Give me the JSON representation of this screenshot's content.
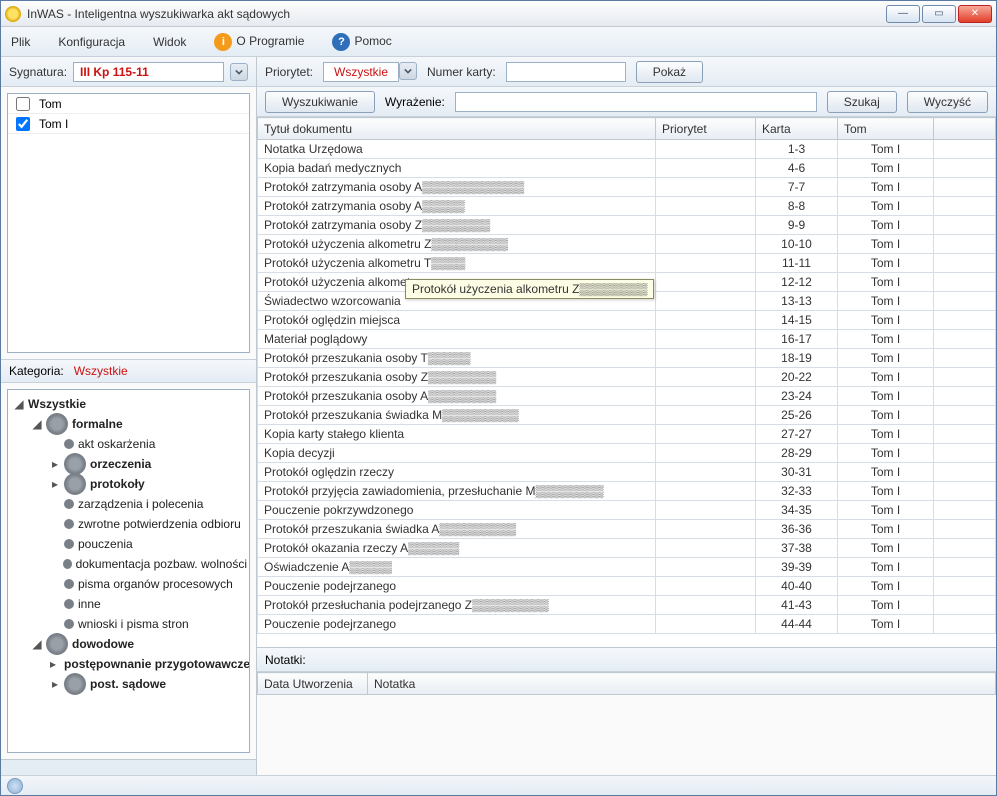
{
  "window": {
    "title": "InWAS - Inteligentna wyszukiwarka akt sądowych"
  },
  "menu": {
    "file": "Plik",
    "config": "Konfiguracja",
    "view": "Widok",
    "about": "O Programie",
    "help": "Pomoc"
  },
  "signature": {
    "label": "Sygnatura:",
    "value": "III Kp 115-11"
  },
  "toms": {
    "header": "Tom",
    "items": [
      "Tom I"
    ]
  },
  "category": {
    "label": "Kategoria:",
    "value": "Wszystkie"
  },
  "tree": {
    "root": "Wszystkie",
    "formalne": "formalne",
    "formalne_children_simple": [
      "akt oskarżenia"
    ],
    "formalne_children_exp": [
      "orzeczenia",
      "protokoły"
    ],
    "formalne_children_rest": [
      "zarządzenia i polecenia",
      "zwrotne potwierdzenia odbioru",
      "pouczenia",
      "dokumentacja pozbaw. wolności",
      "pisma organów procesowych",
      "inne",
      "wnioski i pisma stron"
    ],
    "dowodowe": "dowodowe",
    "dowodowe_children": [
      "postępownanie przygotowawcze",
      "post. sądowe"
    ]
  },
  "filter": {
    "priority_label": "Priorytet:",
    "priority_value": "Wszystkie",
    "card_label": "Numer karty:",
    "show": "Pokaż"
  },
  "search": {
    "mode": "Wyszukiwanie",
    "expr_label": "Wyrażenie:",
    "search": "Szukaj",
    "clear": "Wyczyść"
  },
  "columns": {
    "title": "Tytuł dokumentu",
    "priority": "Priorytet",
    "card": "Karta",
    "tom": "Tom"
  },
  "rows": [
    {
      "t": "Notatka Urzędowa",
      "k": "1-3",
      "m": "Tom I"
    },
    {
      "t": "Kopia badań medycznych",
      "k": "4-6",
      "m": "Tom I"
    },
    {
      "t": "Protokół zatrzymania osoby A▒▒▒▒▒▒▒▒▒▒▒▒",
      "k": "7-7",
      "m": "Tom I"
    },
    {
      "t": "Protokół zatrzymania osoby A▒▒▒▒▒",
      "k": "8-8",
      "m": "Tom I"
    },
    {
      "t": "Protokół zatrzymania osoby Z▒▒▒▒▒▒▒▒",
      "k": "9-9",
      "m": "Tom I"
    },
    {
      "t": "Protokół użyczenia alkometru Z▒▒▒▒▒▒▒▒▒",
      "k": "10-10",
      "m": "Tom I"
    },
    {
      "t": "Protokół użyczenia alkometru T▒▒▒▒",
      "k": "11-11",
      "m": "Tom I"
    },
    {
      "t": "Protokół użyczenia alkometru",
      "k": "12-12",
      "m": "Tom I"
    },
    {
      "t": "Świadectwo wzorcowania",
      "k": "13-13",
      "m": "Tom I"
    },
    {
      "t": "Protokół oględzin miejsca",
      "k": "14-15",
      "m": "Tom I"
    },
    {
      "t": "Materiał poglądowy",
      "k": "16-17",
      "m": "Tom I"
    },
    {
      "t": "Protokół przeszukania osoby T▒▒▒▒▒",
      "k": "18-19",
      "m": "Tom I"
    },
    {
      "t": "Protokół przeszukania osoby Z▒▒▒▒▒▒▒▒",
      "k": "20-22",
      "m": "Tom I"
    },
    {
      "t": "Protokół przeszukania osoby A▒▒▒▒▒▒▒▒",
      "k": "23-24",
      "m": "Tom I"
    },
    {
      "t": "Protokół przeszukania świadka M▒▒▒▒▒▒▒▒▒",
      "k": "25-26",
      "m": "Tom I"
    },
    {
      "t": "Kopia karty stałego klienta",
      "k": "27-27",
      "m": "Tom I"
    },
    {
      "t": "Kopia decyzji",
      "k": "28-29",
      "m": "Tom I"
    },
    {
      "t": "Protokół oględzin rzeczy",
      "k": "30-31",
      "m": "Tom I"
    },
    {
      "t": "Protokół przyjęcia zawiadomienia, przesłuchanie M▒▒▒▒▒▒▒▒",
      "k": "32-33",
      "m": "Tom I"
    },
    {
      "t": "Pouczenie pokrzywdzonego",
      "k": "34-35",
      "m": "Tom I"
    },
    {
      "t": "Protokół przeszukania świadka A▒▒▒▒▒▒▒▒▒",
      "k": "36-36",
      "m": "Tom I"
    },
    {
      "t": "Protokół okazania rzeczy A▒▒▒▒▒▒",
      "k": "37-38",
      "m": "Tom I"
    },
    {
      "t": "Oświadczenie A▒▒▒▒▒",
      "k": "39-39",
      "m": "Tom I"
    },
    {
      "t": "Pouczenie podejrzanego",
      "k": "40-40",
      "m": "Tom I"
    },
    {
      "t": "Protokół przesłuchania podejrzanego Z▒▒▒▒▒▒▒▒▒",
      "k": "41-43",
      "m": "Tom I"
    },
    {
      "t": "Pouczenie podejrzanego",
      "k": "44-44",
      "m": "Tom I"
    }
  ],
  "tooltip": "Protokół użyczenia alkometru Z▒▒▒▒▒▒▒▒",
  "notes": {
    "label": "Notatki:",
    "col_date": "Data Utworzenia",
    "col_note": "Notatka"
  }
}
